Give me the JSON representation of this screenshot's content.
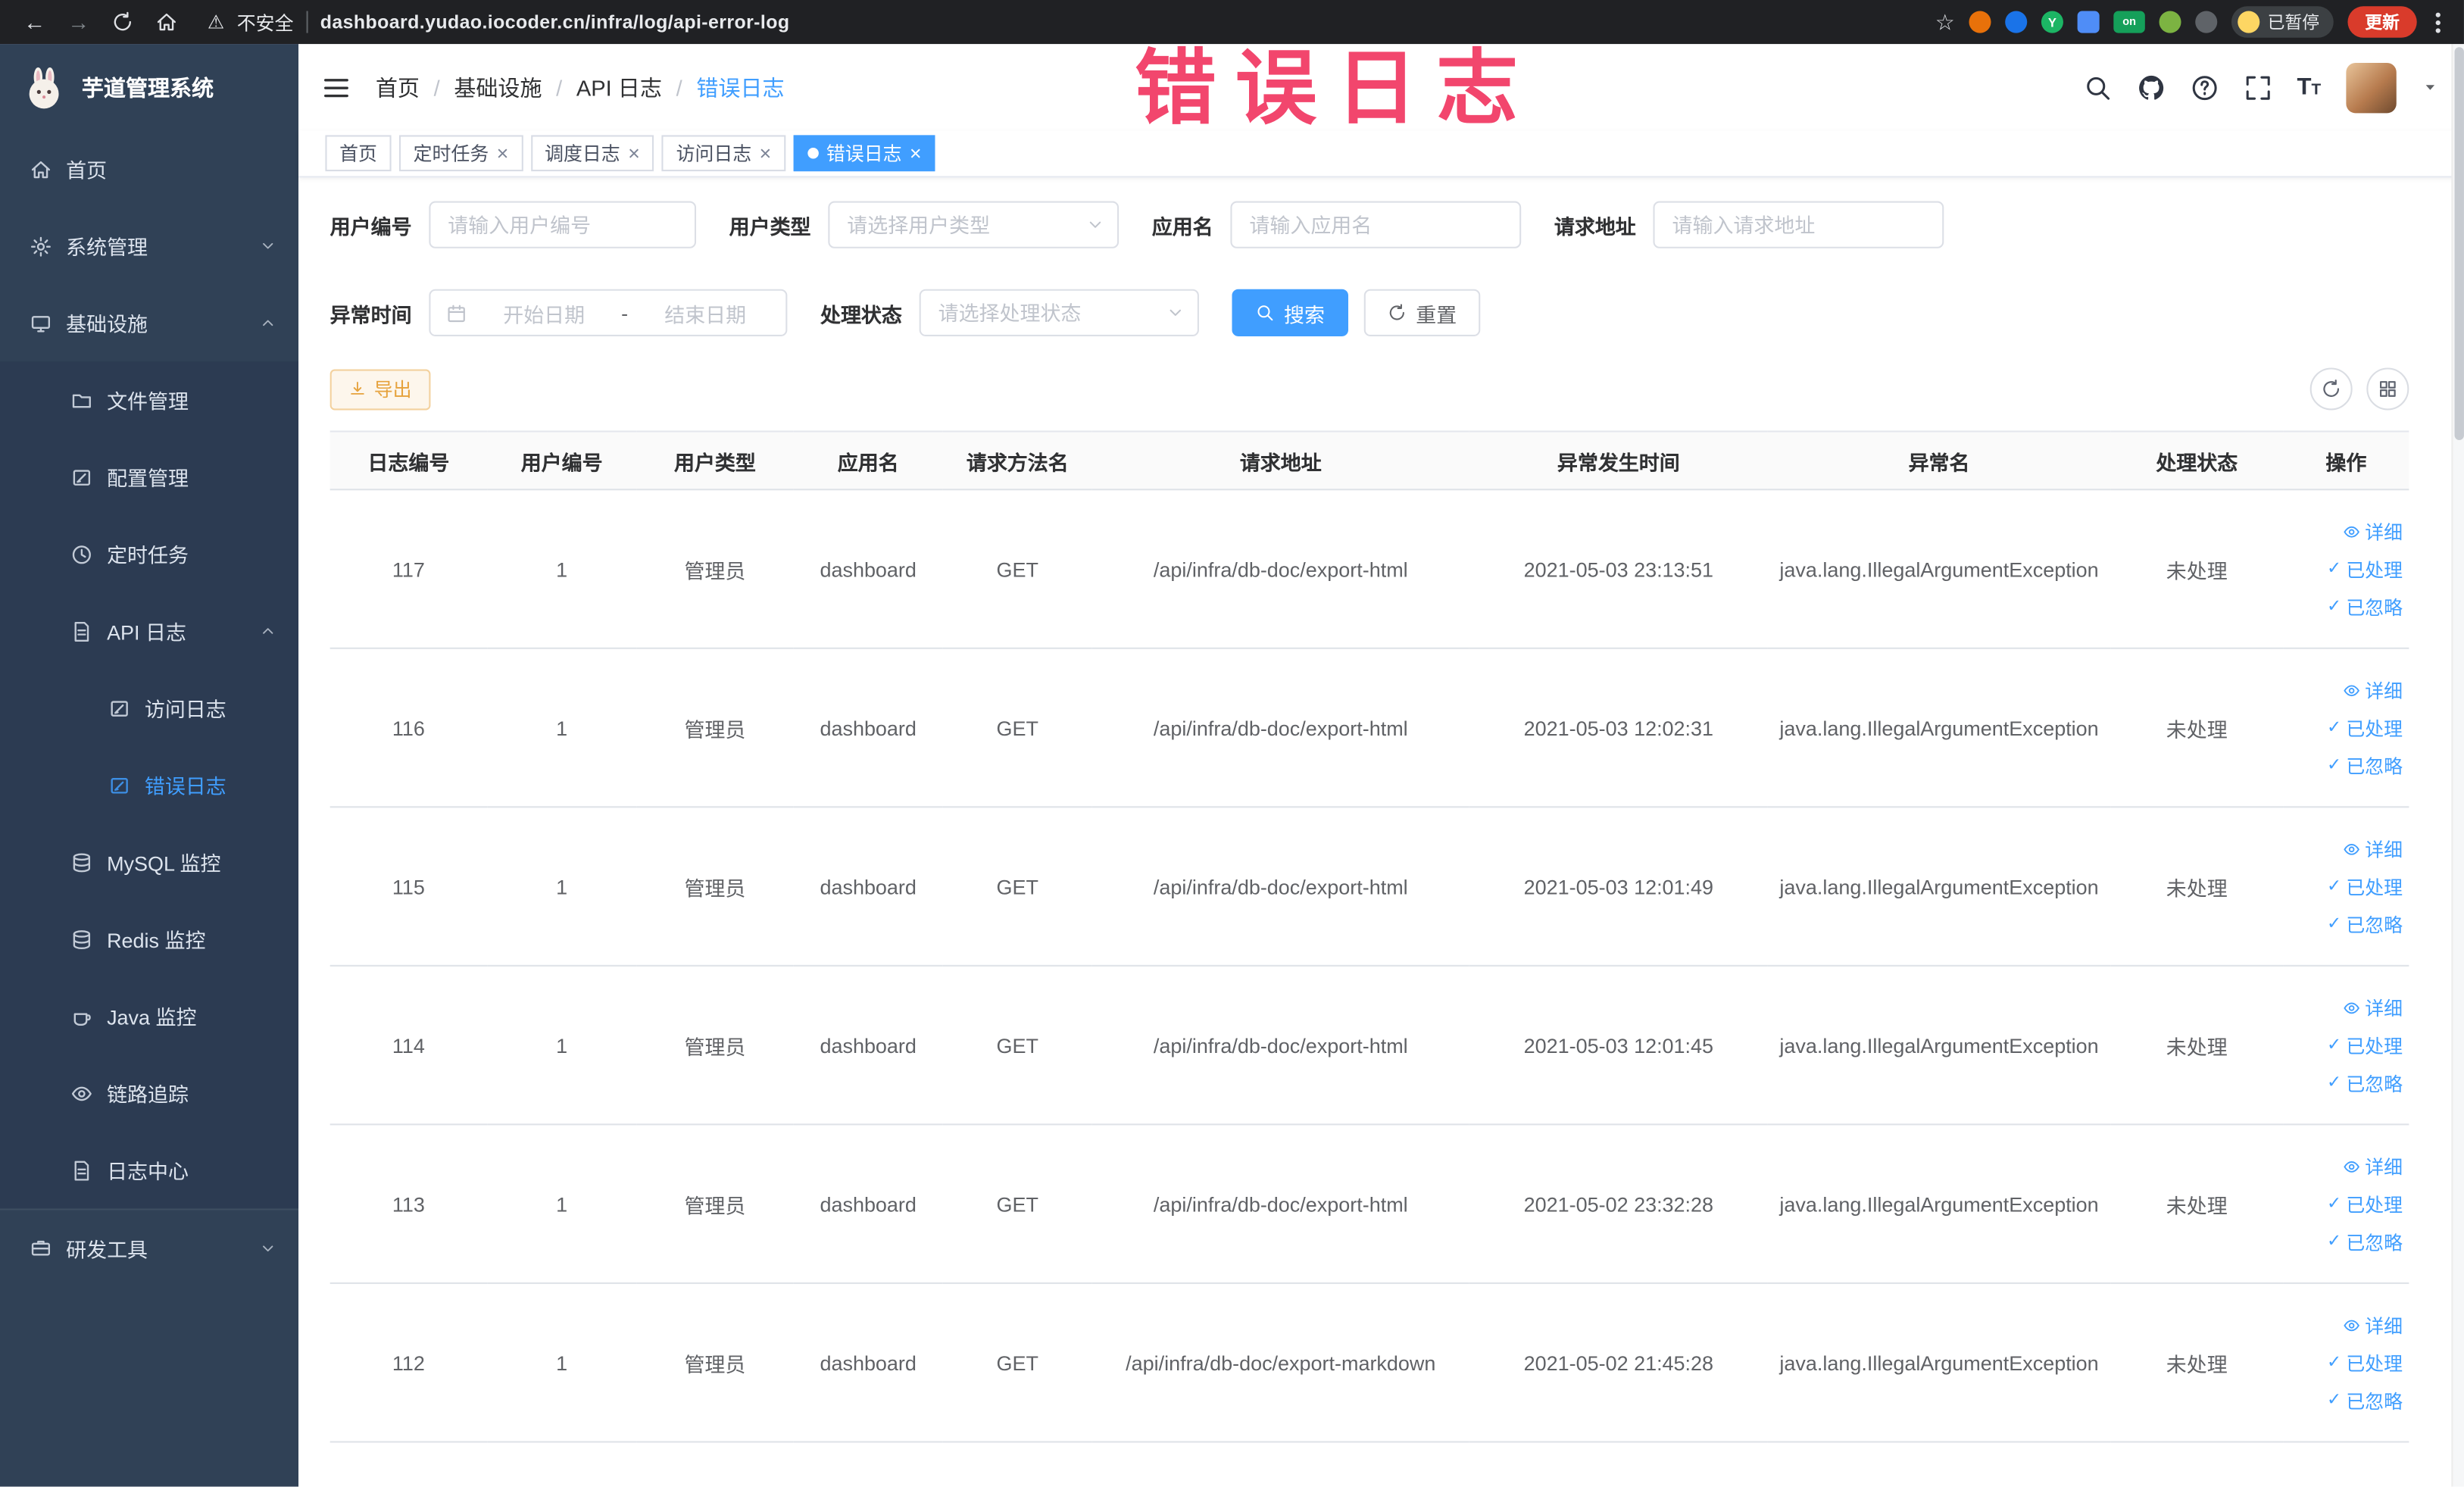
{
  "browser": {
    "security_label": "不安全",
    "url": "dashboard.yudao.iocoder.cn/infra/log/api-error-log",
    "paused_badge": "已暂停",
    "update_label": "更新",
    "extension_letter_y": "Y",
    "extension_badge_on": "on"
  },
  "annotation_text": "错误日志",
  "sidebar": {
    "logo_title": "芋道管理系统",
    "menu": {
      "home": "首页",
      "system": "系统管理",
      "infra": "基础设施",
      "file": "文件管理",
      "config": "配置管理",
      "job": "定时任务",
      "api_log": "API 日志",
      "access_log": "访问日志",
      "error_log": "错误日志",
      "mysql": "MySQL 监控",
      "redis": "Redis 监控",
      "java": "Java 监控",
      "trace": "链路追踪",
      "log_center": "日志中心",
      "dev_tools": "研发工具"
    }
  },
  "breadcrumb": [
    "首页",
    "基础设施",
    "API 日志",
    "错误日志"
  ],
  "tabs": [
    {
      "label": "首页",
      "closable": false,
      "active": false
    },
    {
      "label": "定时任务",
      "closable": true,
      "active": false
    },
    {
      "label": "调度日志",
      "closable": true,
      "active": false
    },
    {
      "label": "访问日志",
      "closable": true,
      "active": false
    },
    {
      "label": "错误日志",
      "closable": true,
      "active": true
    }
  ],
  "filters": {
    "user_id_label": "用户编号",
    "user_id_placeholder": "请输入用户编号",
    "user_type_label": "用户类型",
    "user_type_placeholder": "请选择用户类型",
    "app_name_label": "应用名",
    "app_name_placeholder": "请输入应用名",
    "request_url_label": "请求地址",
    "request_url_placeholder": "请输入请求地址",
    "exception_time_label": "异常时间",
    "date_start_placeholder": "开始日期",
    "date_separator": "-",
    "date_end_placeholder": "结束日期",
    "process_status_label": "处理状态",
    "process_status_placeholder": "请选择处理状态",
    "search_button": "搜索",
    "reset_button": "重置"
  },
  "toolbar": {
    "export_button": "导出"
  },
  "table": {
    "headers": [
      "日志编号",
      "用户编号",
      "用户类型",
      "应用名",
      "请求方法名",
      "请求地址",
      "异常发生时间",
      "异常名",
      "处理状态",
      "操作"
    ],
    "actions": {
      "detail": "详细",
      "processed": "已处理",
      "ignored": "已忽略"
    },
    "rows": [
      {
        "id": "117",
        "user_id": "1",
        "user_type": "管理员",
        "app": "dashboard",
        "method": "GET",
        "url": "/api/infra/db-doc/export-html",
        "time": "2021-05-03 23:13:51",
        "exception": "java.lang.IllegalArgumentException",
        "status": "未处理"
      },
      {
        "id": "116",
        "user_id": "1",
        "user_type": "管理员",
        "app": "dashboard",
        "method": "GET",
        "url": "/api/infra/db-doc/export-html",
        "time": "2021-05-03 12:02:31",
        "exception": "java.lang.IllegalArgumentException",
        "status": "未处理"
      },
      {
        "id": "115",
        "user_id": "1",
        "user_type": "管理员",
        "app": "dashboard",
        "method": "GET",
        "url": "/api/infra/db-doc/export-html",
        "time": "2021-05-03 12:01:49",
        "exception": "java.lang.IllegalArgumentException",
        "status": "未处理"
      },
      {
        "id": "114",
        "user_id": "1",
        "user_type": "管理员",
        "app": "dashboard",
        "method": "GET",
        "url": "/api/infra/db-doc/export-html",
        "time": "2021-05-03 12:01:45",
        "exception": "java.lang.IllegalArgumentException",
        "status": "未处理"
      },
      {
        "id": "113",
        "user_id": "1",
        "user_type": "管理员",
        "app": "dashboard",
        "method": "GET",
        "url": "/api/infra/db-doc/export-html",
        "time": "2021-05-02 23:32:28",
        "exception": "java.lang.IllegalArgumentException",
        "status": "未处理"
      },
      {
        "id": "112",
        "user_id": "1",
        "user_type": "管理员",
        "app": "dashboard",
        "method": "GET",
        "url": "/api/infra/db-doc/export-markdown",
        "time": "2021-05-02 21:45:28",
        "exception": "java.lang.IllegalArgumentException",
        "status": "未处理"
      }
    ]
  },
  "colors": {
    "accent": "#409EFF",
    "sidebar_bg": "#304156",
    "warning": "#E6A23C",
    "chrome_bg": "#202124",
    "annotation": "#F2466D",
    "update_button_bg": "#D93B2B"
  }
}
